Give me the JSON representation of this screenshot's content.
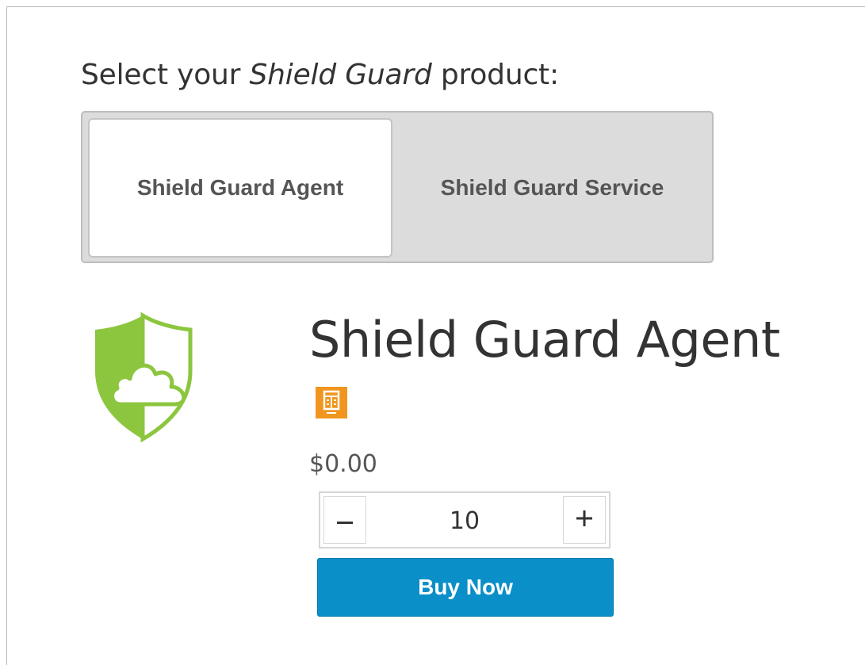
{
  "selector": {
    "label_prefix": "Select your ",
    "label_product": "Shield Guard",
    "label_suffix": " product:",
    "options": [
      {
        "label": "Shield Guard Agent",
        "selected": true
      },
      {
        "label": "Shield Guard Service",
        "selected": false
      }
    ]
  },
  "product": {
    "title": "Shield Guard Agent",
    "logo_icon": "shield-cloud-icon",
    "badge_icon": "server-badge-icon",
    "price": "$0.00"
  },
  "quantity": {
    "value": "10",
    "minus_icon": "minus-icon",
    "plus_icon": "plus-icon"
  },
  "buy_button": {
    "label": "Buy Now"
  },
  "colors": {
    "shield_green": "#8cc63f",
    "badge_orange": "#f0961f",
    "buy_blue": "#0a8fc8"
  }
}
